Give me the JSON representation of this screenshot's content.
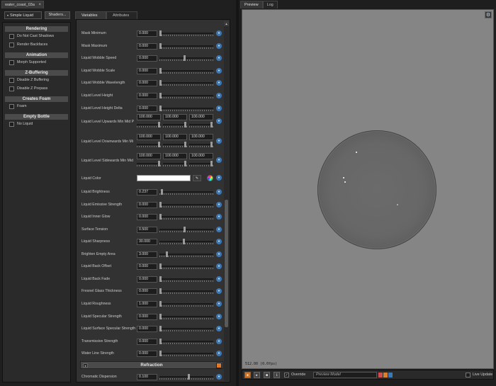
{
  "document_tab": {
    "title": "water_coast_03a",
    "close": "×"
  },
  "shader_select": "Simple Liquid",
  "shaders_button": "Shaders...",
  "left_sections": [
    {
      "title": "Rendering",
      "options": [
        {
          "label": "Do Not Cast Shadows",
          "checked": false
        },
        {
          "label": "Render Backfaces",
          "checked": false
        }
      ]
    },
    {
      "title": "Animation",
      "options": [
        {
          "label": "Morph Supported",
          "checked": false
        }
      ]
    },
    {
      "title": "Z-Buffering",
      "options": [
        {
          "label": "Disable Z Buffering",
          "checked": false
        },
        {
          "label": "Disable Z Prepass",
          "checked": false
        }
      ]
    },
    {
      "title": "Creates Foam",
      "options": [
        {
          "label": "Foam",
          "checked": false
        }
      ]
    },
    {
      "title": "Empty Bottle",
      "options": [
        {
          "label": "No Liquid",
          "checked": false
        }
      ]
    }
  ],
  "center_tabs": [
    "Variables",
    "Attributes"
  ],
  "properties_a": [
    {
      "label": "Mask Minimum",
      "value": "0.000",
      "level": 0.0
    },
    {
      "label": "Mask Maximum",
      "value": "0.000",
      "level": 0.0
    },
    {
      "label": "Liquid Wobble Speed",
      "value": "0.000",
      "level": 0.47
    },
    {
      "label": "Liquid Wobble Scale",
      "value": "0.000",
      "level": 0.0
    },
    {
      "label": "Liquid Wobble Wavelength",
      "value": "0.000",
      "level": 0.0
    },
    {
      "label": "Liquid Level Height",
      "value": "0.000",
      "level": 0.0
    },
    {
      "label": "Liquid Level Height Delta",
      "value": "0.000",
      "level": 0.0
    }
  ],
  "vector_properties": [
    {
      "label": "Liquid Level Upwards Min Mid P",
      "values": [
        "100.000",
        "100.000",
        "100.000"
      ]
    },
    {
      "label": "Liquid Level Downwards Min Mi",
      "values": [
        "100.000",
        "100.000",
        "100.000"
      ]
    },
    {
      "label": "Liquid Level Sidewards Min Mid",
      "values": [
        "100.000",
        "100.000",
        "100.000"
      ]
    }
  ],
  "liquid_color": {
    "label": "Liquid Color",
    "value": "#ffffff",
    "picker_icon": "eyedropper-icon",
    "wheel_icon": "color-wheel-icon"
  },
  "properties_b": [
    {
      "label": "Liquid Brightness",
      "value": "0.237",
      "level": 0.03
    },
    {
      "label": "Liquid Emissive Strength",
      "value": "0.000",
      "level": 0.0
    },
    {
      "label": "Liquid Inner Glow",
      "value": "0.000",
      "level": 0.0
    },
    {
      "label": "Surface Tension",
      "value": "0.500",
      "level": 0.47
    },
    {
      "label": "Liquid Sharpness",
      "value": "30.000",
      "level": 0.45
    },
    {
      "label": "Brighten Empty Area",
      "value": "3.000",
      "level": 0.12
    },
    {
      "label": "Liquid Back Offset",
      "value": "0.000",
      "level": 0.0
    },
    {
      "label": "Liquid Back Fade",
      "value": "0.000",
      "level": 0.0
    },
    {
      "label": "Fresnel Glass Thickness",
      "value": "0.000",
      "level": 0.0
    },
    {
      "label": "Liquid Roughness",
      "value": "1.000",
      "level": 0.0
    },
    {
      "label": "Liquid Specular Strength",
      "value": "0.000",
      "level": 0.0
    },
    {
      "label": "Liquid Surface Specular Strength",
      "value": "0.000",
      "level": 0.0
    },
    {
      "label": "Transmissive Strength",
      "value": "0.000",
      "level": 0.0
    },
    {
      "label": "Water Line Strength",
      "value": "0.000",
      "level": 0.0
    }
  ],
  "refraction_section": {
    "title": "Refraction"
  },
  "properties_c": [
    {
      "label": "Chromatic Dispersion",
      "value": "0.100",
      "level": 0.55
    }
  ],
  "preview_tabs": [
    "Preview",
    "Log"
  ],
  "viewport": {
    "stats": "512.00 (0.0fps)"
  },
  "bottom_bar": {
    "override_label": "Override",
    "override_checked": true,
    "model_placeholder": "Preview Model",
    "live_update_label": "Live Update",
    "live_update_checked": false
  },
  "colors": {
    "accent_blue": "#3c78b4",
    "record_orange": "#c9732b",
    "viewport_bg": "#858585"
  }
}
